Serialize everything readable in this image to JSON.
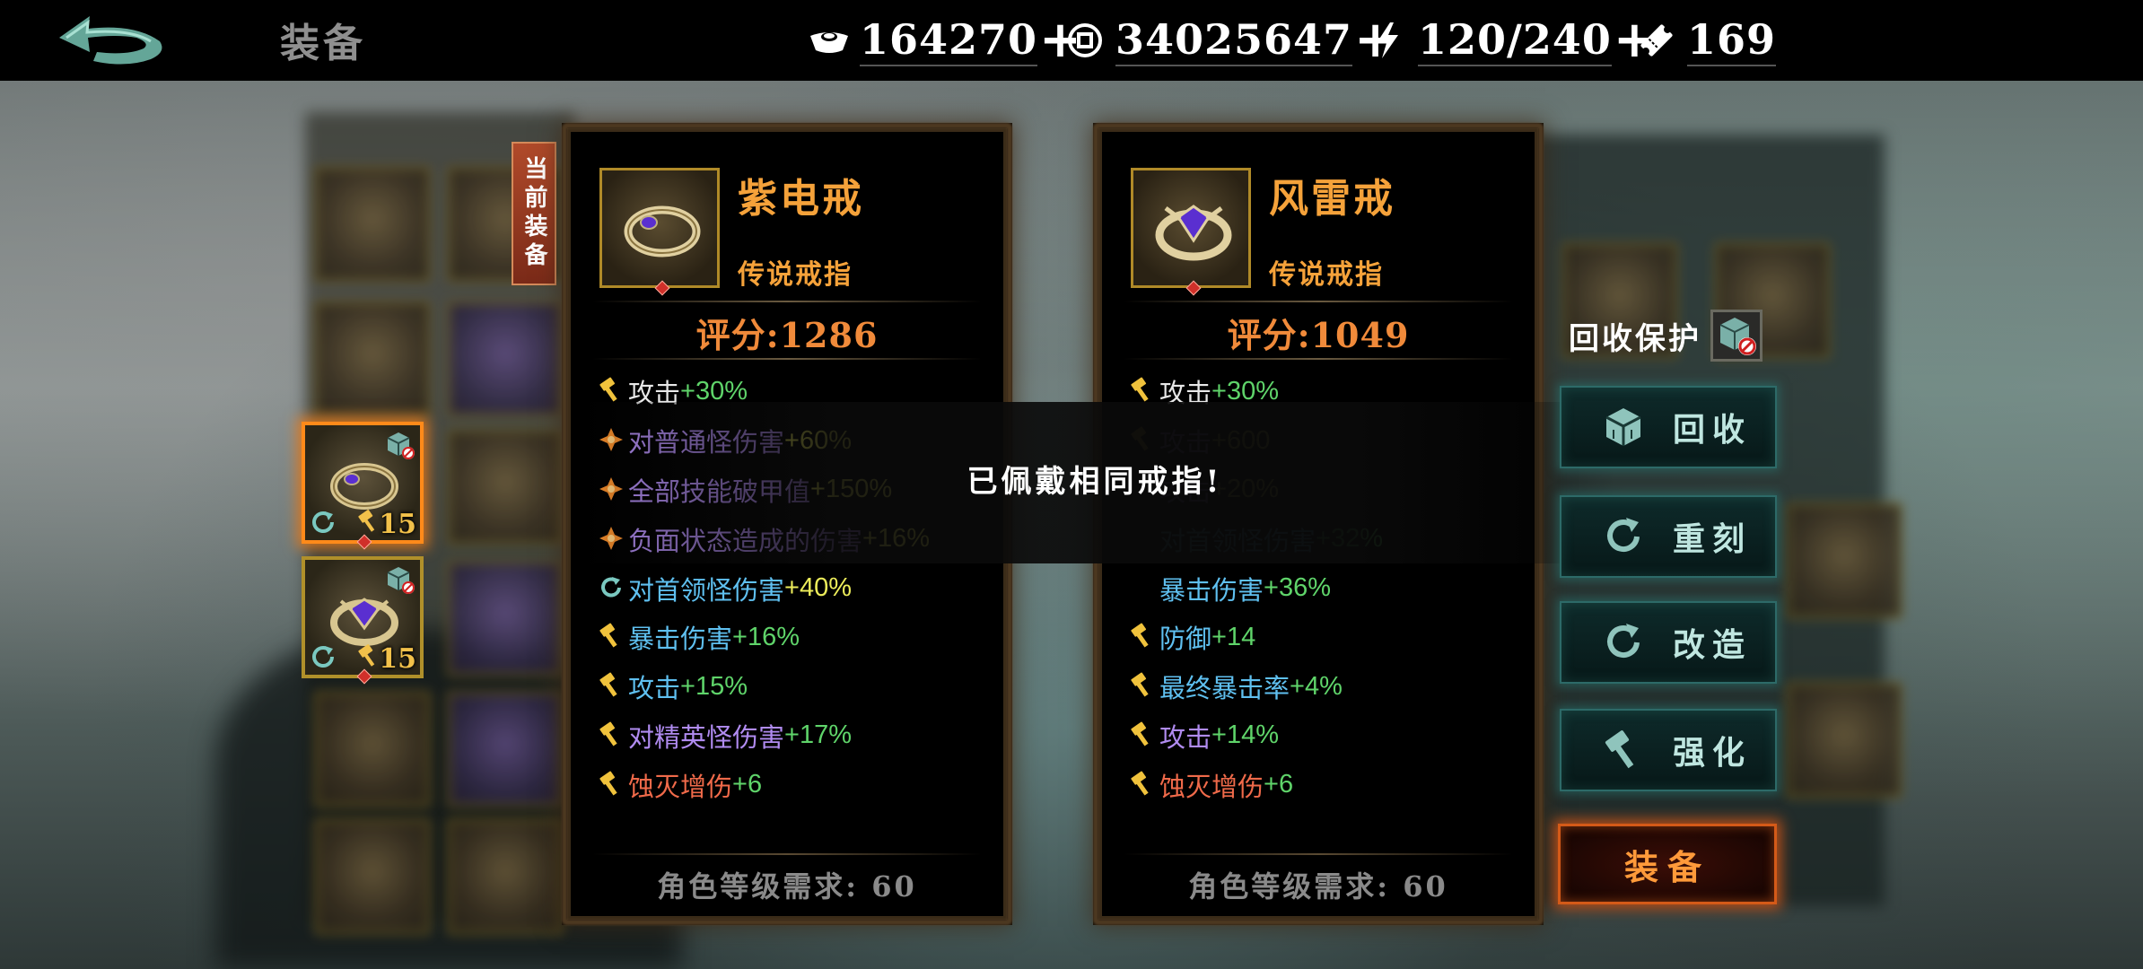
{
  "header": {
    "title": "装备",
    "resources": [
      {
        "icon": "ingot-icon",
        "value": "164270",
        "has_add": true
      },
      {
        "icon": "coin-icon",
        "value": "34025647",
        "has_add": true
      },
      {
        "icon": "energy-icon",
        "value": "120/240",
        "has_add": true
      },
      {
        "icon": "ticket-icon",
        "value": "169",
        "has_add": false
      }
    ],
    "add_symbol": "+"
  },
  "equipped_tag": "当前装备",
  "inventory": {
    "items": [
      {
        "level": "15",
        "selected": true
      },
      {
        "level": "15",
        "selected": false
      }
    ]
  },
  "cards": [
    {
      "name": "紫电戒",
      "rarity": "传说戒指",
      "score": "评分:1286",
      "stats": [
        {
          "icon": "hammer-stat-icon",
          "label": "攻击",
          "value": "+30%",
          "label_color": "#e8e8e8",
          "value_color": "#5fd46a",
          "dim": false
        },
        {
          "icon": "spark-stat-icon",
          "label": "对普通怪伤害",
          "value": "+60%",
          "label_color": "#b08bf0",
          "value_color": "#ecec5a",
          "dim": false
        },
        {
          "icon": "spark-stat-icon",
          "label": "全部技能破甲值",
          "value": "+150%",
          "label_color": "#b08bf0",
          "value_color": "#ecec5a",
          "dim": false
        },
        {
          "icon": "spark-stat-icon",
          "label": "负面状态造成的伤害",
          "value": "+16%",
          "label_color": "#b08bf0",
          "value_color": "#ecec5a",
          "dim": false
        },
        {
          "icon": "cycle-stat-icon",
          "label": "对首领怪伤害",
          "value": "+40%",
          "label_color": "#5fc0f0",
          "value_color": "#ecec5a",
          "dim": false
        },
        {
          "icon": "hammer-stat-icon",
          "label": "暴击伤害",
          "value": "+16%",
          "label_color": "#5fc0f0",
          "value_color": "#5fd46a",
          "dim": false
        },
        {
          "icon": "hammer-stat-icon",
          "label": "攻击",
          "value": "+15%",
          "label_color": "#5fc0f0",
          "value_color": "#5fd46a",
          "dim": false
        },
        {
          "icon": "hammer-stat-icon",
          "label": "对精英怪伤害",
          "value": "+17%",
          "label_color": "#b08bf0",
          "value_color": "#5fd46a",
          "dim": false
        },
        {
          "icon": "hammer-stat-icon",
          "label": "蚀灭增伤",
          "value": "+6",
          "label_color": "#f06a4a",
          "value_color": "#5fd46a",
          "dim": false
        }
      ],
      "requirement": "角色等级需求: 60"
    },
    {
      "name": "风雷戒",
      "rarity": "传说戒指",
      "score": "评分:1049",
      "stats": [
        {
          "icon": "hammer-stat-icon",
          "label": "攻击",
          "value": "+30%",
          "label_color": "#e8e8e8",
          "value_color": "#5fd46a",
          "dim": false
        },
        {
          "icon": "hammer-stat-icon",
          "label": "攻击",
          "value": "+600",
          "label_color": "#b08bf0",
          "value_color": "#ecec5a",
          "dim": true
        },
        {
          "icon": "",
          "label": "攻击",
          "value": "+20%",
          "label_color": "#b08bf0",
          "value_color": "#ecec5a",
          "dim": true
        },
        {
          "icon": "",
          "label": "对首领怪伤害",
          "value": "+32%",
          "label_color": "#5fc0f0",
          "value_color": "#5fd46a",
          "dim": true
        },
        {
          "icon": "",
          "label": "暴击伤害",
          "value": "+36%",
          "label_color": "#5fc0f0",
          "value_color": "#5fd46a",
          "dim": false
        },
        {
          "icon": "hammer-stat-icon",
          "label": "防御",
          "value": "+14",
          "label_color": "#5fc0f0",
          "value_color": "#5fd46a",
          "dim": false
        },
        {
          "icon": "hammer-stat-icon",
          "label": "最终暴击率",
          "value": "+4%",
          "label_color": "#5fc0f0",
          "value_color": "#5fd46a",
          "dim": false
        },
        {
          "icon": "hammer-stat-icon",
          "label": "攻击",
          "value": "+14%",
          "label_color": "#b08bf0",
          "value_color": "#5fd46a",
          "dim": false
        },
        {
          "icon": "hammer-stat-icon",
          "label": "蚀灭增伤",
          "value": "+6",
          "label_color": "#f06a4a",
          "value_color": "#5fd46a",
          "dim": false
        }
      ],
      "requirement": "角色等级需求: 60"
    }
  ],
  "toast": "已佩戴相同戒指!",
  "actions": {
    "protect_label": "回收保护",
    "recycle": "回收",
    "reforge": "重刻",
    "modify": "改造",
    "enhance": "强化",
    "equip": "装备"
  },
  "colors": {
    "accent_orange": "#f5a23a",
    "action_teal": "#2d6a68",
    "equip_orange": "#d45a18"
  }
}
